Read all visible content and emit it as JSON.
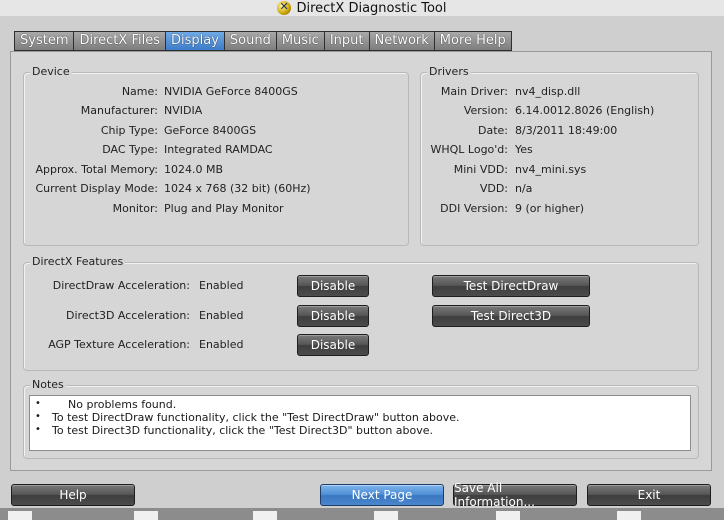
{
  "window": {
    "title": "DirectX Diagnostic Tool"
  },
  "tabs": [
    {
      "label": "System"
    },
    {
      "label": "DirectX Files"
    },
    {
      "label": "Display"
    },
    {
      "label": "Sound"
    },
    {
      "label": "Music"
    },
    {
      "label": "Input"
    },
    {
      "label": "Network"
    },
    {
      "label": "More Help"
    }
  ],
  "device": {
    "title": "Device",
    "rows": [
      {
        "label": "Name:",
        "value": "NVIDIA GeForce 8400GS"
      },
      {
        "label": "Manufacturer:",
        "value": "NVIDIA"
      },
      {
        "label": "Chip Type:",
        "value": "GeForce 8400GS"
      },
      {
        "label": "DAC Type:",
        "value": "Integrated RAMDAC"
      },
      {
        "label": "Approx. Total Memory:",
        "value": "1024.0 MB"
      },
      {
        "label": "Current Display Mode:",
        "value": "1024 x 768 (32 bit) (60Hz)"
      },
      {
        "label": "Monitor:",
        "value": "Plug and Play Monitor"
      }
    ]
  },
  "drivers": {
    "title": "Drivers",
    "rows": [
      {
        "label": "Main Driver:",
        "value": "nv4_disp.dll"
      },
      {
        "label": "Version:",
        "value": "6.14.0012.8026 (English)"
      },
      {
        "label": "Date:",
        "value": "8/3/2011 18:49:00"
      },
      {
        "label": "WHQL Logo'd:",
        "value": "Yes"
      },
      {
        "label": "Mini VDD:",
        "value": "nv4_mini.sys"
      },
      {
        "label": "VDD:",
        "value": "n/a"
      },
      {
        "label": "DDI Version:",
        "value": "9 (or higher)"
      }
    ]
  },
  "features": {
    "title": "DirectX Features",
    "rows": [
      {
        "label": "DirectDraw Acceleration:",
        "status": "Enabled",
        "disable_label": "Disable",
        "test_label": "Test DirectDraw"
      },
      {
        "label": "Direct3D Acceleration:",
        "status": "Enabled",
        "disable_label": "Disable",
        "test_label": "Test Direct3D"
      },
      {
        "label": "AGP Texture Acceleration:",
        "status": "Enabled",
        "disable_label": "Disable"
      }
    ]
  },
  "notes": {
    "title": "Notes",
    "lines": [
      {
        "bullet": "•",
        "text": "No problems found."
      },
      {
        "bullet": "•",
        "text": "To test DirectDraw functionality, click the \"Test DirectDraw\" button above."
      },
      {
        "bullet": "•",
        "text": "To test Direct3D functionality, click the \"Test Direct3D\" button above."
      }
    ]
  },
  "footer": {
    "help_label": "Help",
    "next_page_label": "Next Page",
    "save_all_label": "Save All Information...",
    "exit_label": "Exit"
  },
  "colors": {
    "tab_active": "#4f8fd6",
    "button_dark": "#4c4c4c",
    "panel_bg": "#d6d6d6"
  },
  "icons": {
    "app": "directx-icon"
  }
}
